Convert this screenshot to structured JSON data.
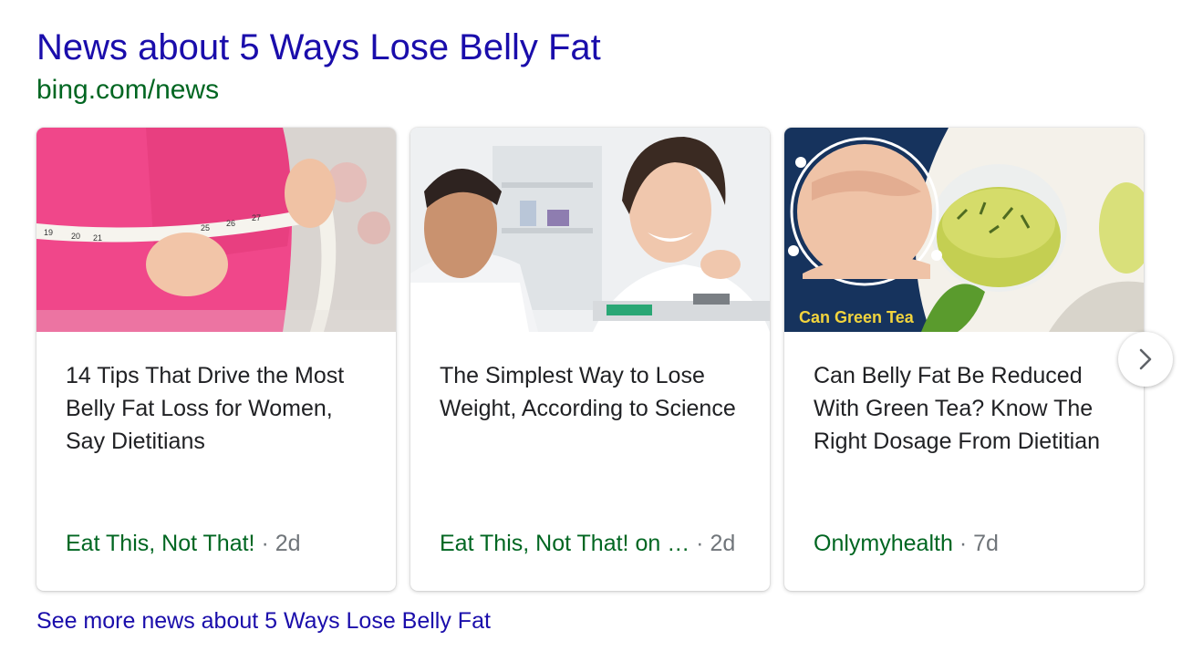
{
  "header": {
    "title": "News about 5 Ways Lose Belly Fat",
    "source": "bing.com/news"
  },
  "cards": [
    {
      "title": "14 Tips That Drive the Most Belly Fat Loss for Women, Say Dietitians",
      "publisher": "Eat This, Not That!",
      "separator": "·",
      "age": "2d"
    },
    {
      "title": "The Simplest Way to Lose Weight, According to Science",
      "publisher": "Eat This, Not That! on …",
      "separator": "·",
      "age": "2d"
    },
    {
      "title": "Can Belly Fat Be Reduced With Green Tea? Know The Right Dosage From Dietitian",
      "publisher": "Onlymyhealth",
      "separator": "·",
      "age": "7d",
      "image_caption": "Can Green Tea"
    }
  ],
  "tape_numbers": [
    "19",
    "20",
    "21",
    "25",
    "26",
    "27"
  ],
  "next_button": {
    "icon": "chevron-right-icon"
  },
  "footer": {
    "more_link": "See more news about 5 Ways Lose Belly Fat"
  },
  "colors": {
    "title_link": "#1a0dab",
    "source_green": "#006621",
    "meta_gray": "#70757a",
    "text": "#202124"
  }
}
